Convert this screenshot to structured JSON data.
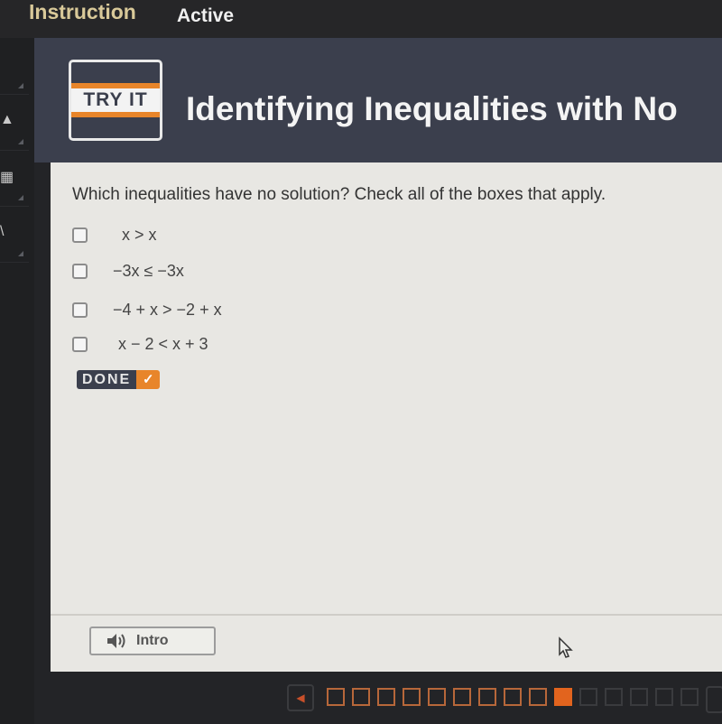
{
  "topbar": {
    "tabs": [
      {
        "label": "Instruction",
        "active": false
      },
      {
        "label": "Active",
        "active": true
      }
    ]
  },
  "header": {
    "badge": "TRY IT",
    "title": "Identifying Inequalities with No",
    "colors": {
      "accent": "#e8852a",
      "header_bg": "#3b3f4d"
    }
  },
  "question": {
    "prompt": "Which inequalities have no solution? Check all of the boxes that apply.",
    "options": [
      {
        "label": "x > x",
        "checked": false
      },
      {
        "label": "−3x ≤ −3x",
        "checked": false
      },
      {
        "label": "−4 + x > −2 + x",
        "checked": false
      },
      {
        "label": "x − 2 < x + 3",
        "checked": false
      }
    ],
    "done_label": "DONE",
    "done_icon": "checkmark-icon"
  },
  "footer": {
    "intro_label": "Intro",
    "intro_icon": "speaker-icon"
  },
  "progress": {
    "total_visible": 15,
    "completed": 9,
    "current": 10
  }
}
